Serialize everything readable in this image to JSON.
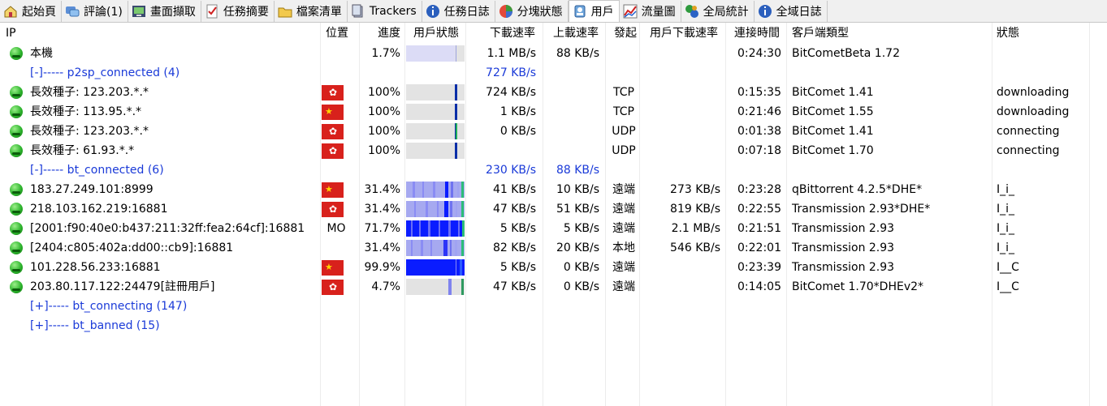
{
  "tabs": [
    {
      "label": "起始頁",
      "icon": "home-icon"
    },
    {
      "label": "評論(1)",
      "icon": "comments-icon"
    },
    {
      "label": "畫面擷取",
      "icon": "screenshot-icon"
    },
    {
      "label": "任務摘要",
      "icon": "task-summary-icon"
    },
    {
      "label": "檔案清單",
      "icon": "file-list-icon"
    },
    {
      "label": "Trackers",
      "icon": "trackers-icon"
    },
    {
      "label": "任務日誌",
      "icon": "task-log-icon"
    },
    {
      "label": "分塊狀態",
      "icon": "pie-chart-icon"
    },
    {
      "label": "用戶",
      "icon": "users-icon",
      "active": true
    },
    {
      "label": "流量圖",
      "icon": "traffic-chart-icon"
    },
    {
      "label": "全局統計",
      "icon": "global-stats-icon"
    },
    {
      "label": "全域日誌",
      "icon": "global-log-icon"
    }
  ],
  "columns": {
    "ip": "IP",
    "loc": "位置",
    "progress": "進度",
    "status_bar": "用戶狀態",
    "down": "下載速率",
    "up": "上載速率",
    "init": "發起",
    "peer_down": "用戶下載速率",
    "time": "連接時間",
    "client": "客戶端類型",
    "state": "狀態"
  },
  "rows": [
    {
      "kind": "peer",
      "ip": "本機",
      "flag": "",
      "loc": "",
      "progress": "1.7%",
      "bar": "self",
      "down": "1.1 MB/s",
      "up": "88 KB/s",
      "init": "",
      "peer_down": "",
      "time": "0:24:30",
      "client": "BitCometBeta 1.72",
      "state": ""
    },
    {
      "kind": "group",
      "ip": "[-]----- p2sp_connected (4)",
      "down": "727 KB/s",
      "up": ""
    },
    {
      "kind": "peer",
      "ip": "長效種子: 123.203.*.*",
      "flag": "hk",
      "loc": "",
      "progress": "100%",
      "bar": "full-a",
      "down": "724 KB/s",
      "up": "",
      "init": "TCP",
      "peer_down": "",
      "time": "0:15:35",
      "client": "BitComet 1.41",
      "state": "downloading"
    },
    {
      "kind": "peer",
      "ip": "長效種子: 113.95.*.*",
      "flag": "cn",
      "loc": "",
      "progress": "100%",
      "bar": "full-b",
      "down": "1 KB/s",
      "up": "",
      "init": "TCP",
      "peer_down": "",
      "time": "0:21:46",
      "client": "BitComet 1.55",
      "state": "downloading"
    },
    {
      "kind": "peer",
      "ip": "長效種子: 123.203.*.*",
      "flag": "hk",
      "loc": "",
      "progress": "100%",
      "bar": "full-c",
      "down": "0 KB/s",
      "up": "",
      "init": "UDP",
      "peer_down": "",
      "time": "0:01:38",
      "client": "BitComet 1.41",
      "state": "connecting"
    },
    {
      "kind": "peer",
      "ip": "長效種子: 61.93.*.*",
      "flag": "hk",
      "loc": "",
      "progress": "100%",
      "bar": "full-d",
      "down": "",
      "up": "",
      "init": "UDP",
      "peer_down": "",
      "time": "0:07:18",
      "client": "BitComet 1.70",
      "state": "connecting"
    },
    {
      "kind": "group",
      "ip": "[-]----- bt_connected (6)",
      "down": "230 KB/s",
      "up": "88 KB/s"
    },
    {
      "kind": "peer",
      "ip": "183.27.249.101:8999",
      "flag": "cn",
      "loc": "",
      "progress": "31.4%",
      "bar": "stripe1",
      "down": "41 KB/s",
      "up": "10 KB/s",
      "init": "遠端",
      "peer_down": "273 KB/s",
      "time": "0:23:28",
      "client": "qBittorrent 4.2.5*DHE*",
      "state": "I_i_"
    },
    {
      "kind": "peer",
      "ip": "218.103.162.219:16881",
      "flag": "hk",
      "loc": "",
      "progress": "31.4%",
      "bar": "stripe2",
      "down": "47 KB/s",
      "up": "51 KB/s",
      "init": "遠端",
      "peer_down": "819 KB/s",
      "time": "0:22:55",
      "client": "Transmission 2.93*DHE*",
      "state": "I_i_"
    },
    {
      "kind": "peer",
      "ip": "[2001:f90:40e0:b437:211:32ff:fea2:64cf]:16881",
      "flag": "",
      "loc": "MO",
      "progress": "71.7%",
      "bar": "stripe3",
      "down": "5 KB/s",
      "up": "5 KB/s",
      "init": "遠端",
      "peer_down": "2.1 MB/s",
      "time": "0:21:51",
      "client": "Transmission 2.93",
      "state": "I_i_"
    },
    {
      "kind": "peer",
      "ip": "[2404:c805:402a:dd00::cb9]:16881",
      "flag": "",
      "loc": "",
      "progress": "31.4%",
      "bar": "stripe4",
      "down": "82 KB/s",
      "up": "20 KB/s",
      "init": "本地",
      "peer_down": "546 KB/s",
      "time": "0:22:01",
      "client": "Transmission 2.93",
      "state": "I_i_"
    },
    {
      "kind": "peer",
      "ip": "101.228.56.233:16881",
      "flag": "cn",
      "loc": "",
      "progress": "99.9%",
      "bar": "solid",
      "down": "5 KB/s",
      "up": "0 KB/s",
      "init": "遠端",
      "peer_down": "",
      "time": "0:23:39",
      "client": "Transmission 2.93",
      "state": "I__C"
    },
    {
      "kind": "peer",
      "ip": "203.80.117.122:24479[註冊用戶]",
      "flag": "hk",
      "loc": "",
      "progress": "4.7%",
      "bar": "sparse",
      "down": "47 KB/s",
      "up": "0 KB/s",
      "init": "遠端",
      "peer_down": "",
      "time": "0:14:05",
      "client": "BitComet 1.70*DHEv2*",
      "state": "I__C"
    },
    {
      "kind": "group",
      "ip": "[+]----- bt_connecting (147)",
      "down": "",
      "up": ""
    },
    {
      "kind": "group",
      "ip": "[+]----- bt_banned (15)",
      "down": "",
      "up": ""
    }
  ],
  "colors": {
    "group_text": "#1a3ad8",
    "bar_blue": "#0a1cff",
    "bar_light": "#a6a9f0",
    "bar_bg": "#e3e3e3"
  }
}
